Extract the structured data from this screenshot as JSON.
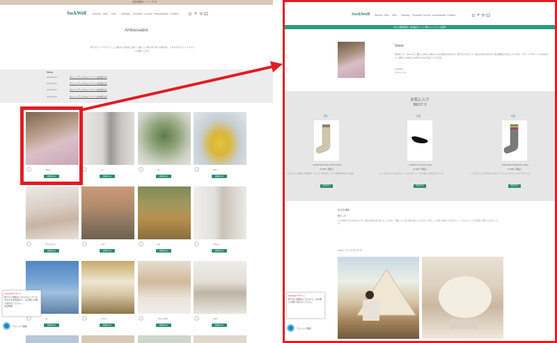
{
  "left": {
    "topbar": "送料無料 / ソックス",
    "logo": "SockWell",
    "nav": [
      "Women",
      "Men",
      "Kids",
      "Sanitary",
      "Sockwell",
      "Journal",
      "Ambassador",
      "Contact"
    ],
    "nav_icons": [
      "search-icon",
      "account-icon",
      "heart-icon",
      "cart-icon"
    ],
    "page_title": "Ambassador",
    "page_desc": "靴下のアンバサダーとして活動する皆様をご紹介。暮らしに寄り添う靴下の魅力を、それぞれのライフスタイルでお届けします。",
    "news": {
      "label": "News",
      "rows": [
        {
          "date": "2023/05/25",
          "text": "ポイントアップキャンペーンのお知らせ"
        },
        {
          "date": "2023/05/01",
          "text": "ポイントアップキャンペーンのお知らせ"
        },
        {
          "date": "2023/04/10",
          "text": "ポイントアップキャンペーンのお知らせ"
        },
        {
          "date": "2023/03/20",
          "text": "ポイントアップキャンペーンのお知らせ"
        }
      ]
    },
    "button_label": "詳細を見る",
    "cards": [
      {
        "name": "Sawa"
      },
      {
        "name": "mi"
      },
      {
        "name": "aoi"
      },
      {
        "name": "Mihu"
      },
      {
        "name": "かんちゃん"
      },
      {
        "name": "Yuki"
      },
      {
        "name": "aki"
      },
      {
        "name": "mifuyu"
      },
      {
        "name": "ryo"
      },
      {
        "name": "hiromi"
      },
      {
        "name": "Yoko_0628"
      },
      {
        "name": "akari"
      }
    ],
    "chat": {
      "title": "Sockwell サポート",
      "body": "靴下のご相談はこちらから。サイズやおすすめ商品など、お気軽にお問い合わせください。",
      "status": "対応時間",
      "footer": "チャットで相談"
    }
  },
  "right": {
    "logo": "SockWell",
    "nav": [
      "Women",
      "Men",
      "Kids",
      "Sanitary",
      "Sockwell",
      "Journal",
      "Ambassador",
      "Contact"
    ],
    "banner": "今なら期間限定！全商品ポイント5倍キャンペーン実施中",
    "profile": {
      "name": "Sawa",
      "text": "初めまして！Sawaです。暮らしの中で心地よいものを選ぶのが好きで、靴下もそのひとつ。毎日の気分に合わせて選ぶ時間を大切にしています。アウトドアやキャンプも大好きで、季節ごとの楽しみを見つけながら過ごしています。",
      "link": "Instagram",
      "handle": "@sawa_style"
    },
    "favorites": {
      "title1": "お気に入り",
      "title2": "BEST 3",
      "items": [
        {
          "rank": "1位",
          "name": "ELEVATED SOLE LATTE  Ladies",
          "price": "¥1,650（税込）",
          "desc": "ふんわりとした履き心地が魅力。クッション性の高いソールで長時間の外出でも快適。",
          "btn": "商品を見る"
        },
        {
          "rank": "2位",
          "name": "DOMINO cut Short  Ladies",
          "price": "¥1,320（税込）",
          "desc": "シューズからちらりと見えるシンプルなデザイン。どんな靴にも合わせやすい一足。",
          "btn": "商品を見る"
        },
        {
          "rank": "3位",
          "name": "ELEVATED ROMANCE  Ladies",
          "price": "¥1,650（税込）",
          "desc": "レトロなラインがかわいいお気に入り。カジュアルなコーデのアクセントに。",
          "btn": "商品を見る"
        }
      ]
    },
    "likes": {
      "label": "好きな場所",
      "sub": "暮らしの",
      "text": "小さな旅をするのが大好きです。週末は自然の中で過ごすことが多く、季節ごとに違う景色を楽しんでいます。お気に入りの靴下を履いて出かけると、いつもより少しだけ足取りが軽くなる気がします。"
    },
    "camping": {
      "label": "オキニソックスコーデ"
    },
    "chat": {
      "title": "Sockwell サポート",
      "body": "靴下のご相談はこちらから。お気軽にお問い合わせください。",
      "footer": "チャットで相談"
    }
  },
  "colors": {
    "brand": "#2a8a6e",
    "highlight": "#e31b23",
    "gray_band": "#e6e6e6"
  }
}
